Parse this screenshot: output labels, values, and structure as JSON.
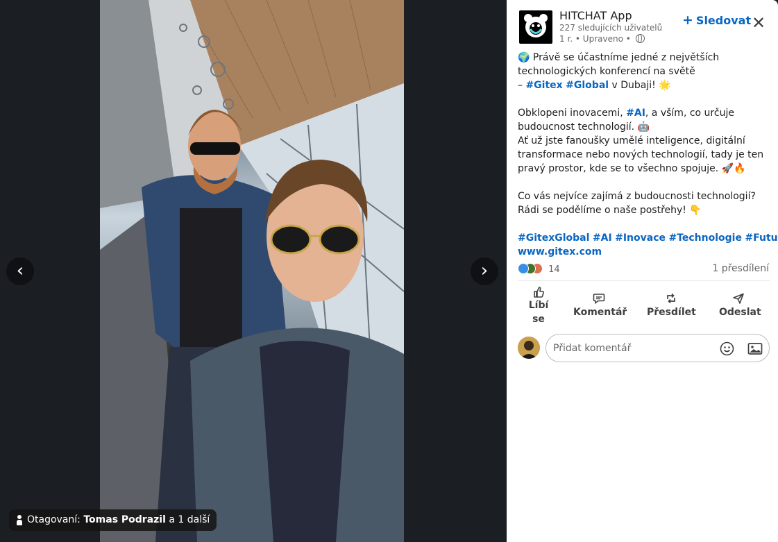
{
  "viewer": {
    "tag_label": "Otagovaní:",
    "tag_person": "Tomas Podrazil",
    "tag_more": "a 1 další",
    "prev_glyph": "‹",
    "next_glyph": "›"
  },
  "post": {
    "company": "HITCHAT App",
    "followers": "227 sledujících uživatelů",
    "meta_time": "1 r. • Upraveno •",
    "follow_label": "Sledovat",
    "close_glyph": "✕",
    "text": {
      "p1_a": "🌍 Právě se účastníme jedné z největších technologických konferencí na světě",
      "p1_b_prefix": "– ",
      "tag_gitex": "#Gitex",
      "tag_global": "#Global",
      "p1_b_suffix": " v Dubaji! 🌟",
      "p2_a": "Obklopeni inovacemi, ",
      "tag_ai": "#AI",
      "p2_b": ", a vším, co určuje budoucnost technologií. 🤖",
      "p3": "Ať už jste fanoušky umělé inteligence, digitální transformace nebo nových technologií, tady je ten pravý prostor, kde se to všechno spojuje. 🚀🔥",
      "p4": "Co vás nejvíce zajímá z budoucnosti technologií? Rádi se podělíme o naše postřehy! 👇",
      "tags_line": [
        "#GitexGlobal",
        "#AI",
        "#Inovace",
        "#Technologie",
        "#FutureTech"
      ],
      "link": "www.gitex.com"
    },
    "reaction_count": "14",
    "reposts": "1 přesdílení",
    "actions": {
      "like": "Líbí se",
      "comment": "Komentář",
      "repost": "Přesdílet",
      "send": "Odeslat"
    },
    "comment_placeholder": "Přidat komentář"
  },
  "colors": {
    "accent": "#0a66c2",
    "viewer_bg": "#1b1f23"
  },
  "icons": [
    "chevron-left-icon",
    "chevron-right-icon",
    "person-icon",
    "globe-icon",
    "plus-icon",
    "close-icon",
    "like-icon",
    "comment-icon",
    "repost-icon",
    "send-icon",
    "emoji-icon",
    "image-icon"
  ]
}
